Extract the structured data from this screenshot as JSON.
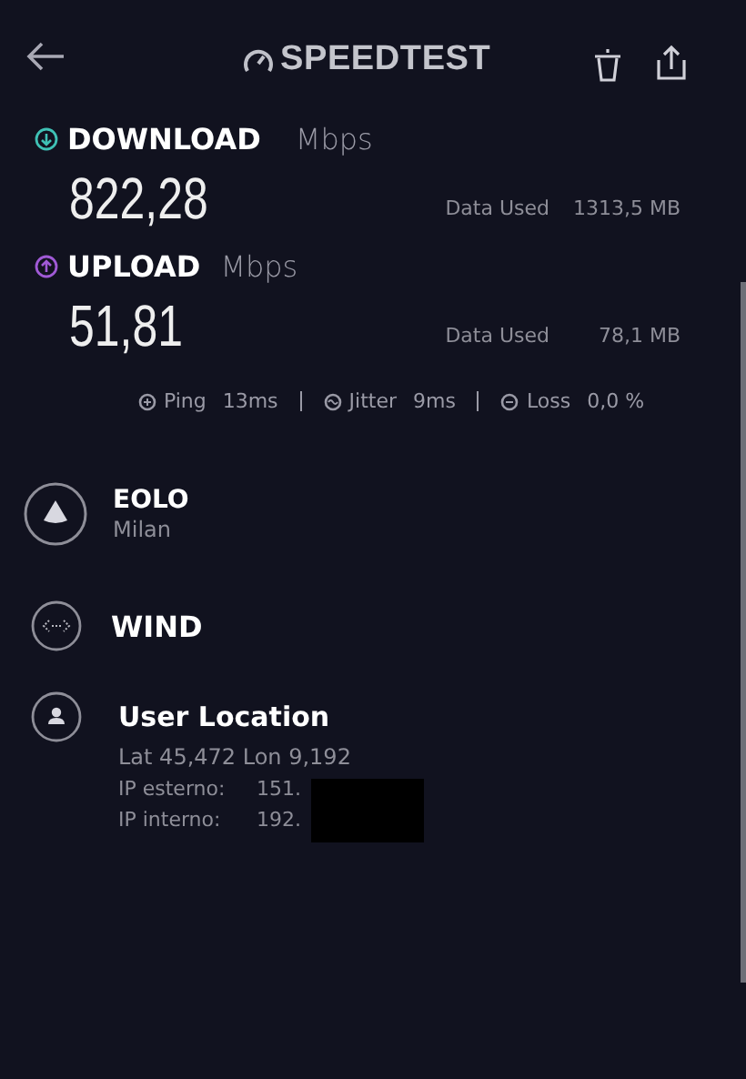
{
  "header": {
    "logo": "SPEEDTEST"
  },
  "results": [
    {
      "kind": "download",
      "label": "DOWNLOAD",
      "unit": "Mbps",
      "value": "822,28",
      "data_label": "Data Used",
      "data_value": "1313,5 MB"
    },
    {
      "kind": "upload",
      "label": "UPLOAD",
      "unit": "Mbps",
      "value": "51,81",
      "data_label": "Data Used",
      "data_value": "78,1 MB"
    }
  ],
  "metrics": [
    {
      "kind": "ping",
      "label": "Ping",
      "value": "13ms"
    },
    {
      "kind": "jitter",
      "label": "Jitter",
      "value": "9ms"
    },
    {
      "kind": "loss",
      "label": "Loss",
      "value": "0,0 %"
    }
  ],
  "server": {
    "name": "EOLO",
    "location": "Milan"
  },
  "provider": {
    "name": "WIND"
  },
  "user_location": {
    "title": "User Location",
    "coords": "Lat 45,472 Lon 9,192",
    "ips": [
      {
        "label": "IP esterno:",
        "value": "151."
      },
      {
        "label": "IP interno:",
        "value": "192."
      }
    ]
  }
}
